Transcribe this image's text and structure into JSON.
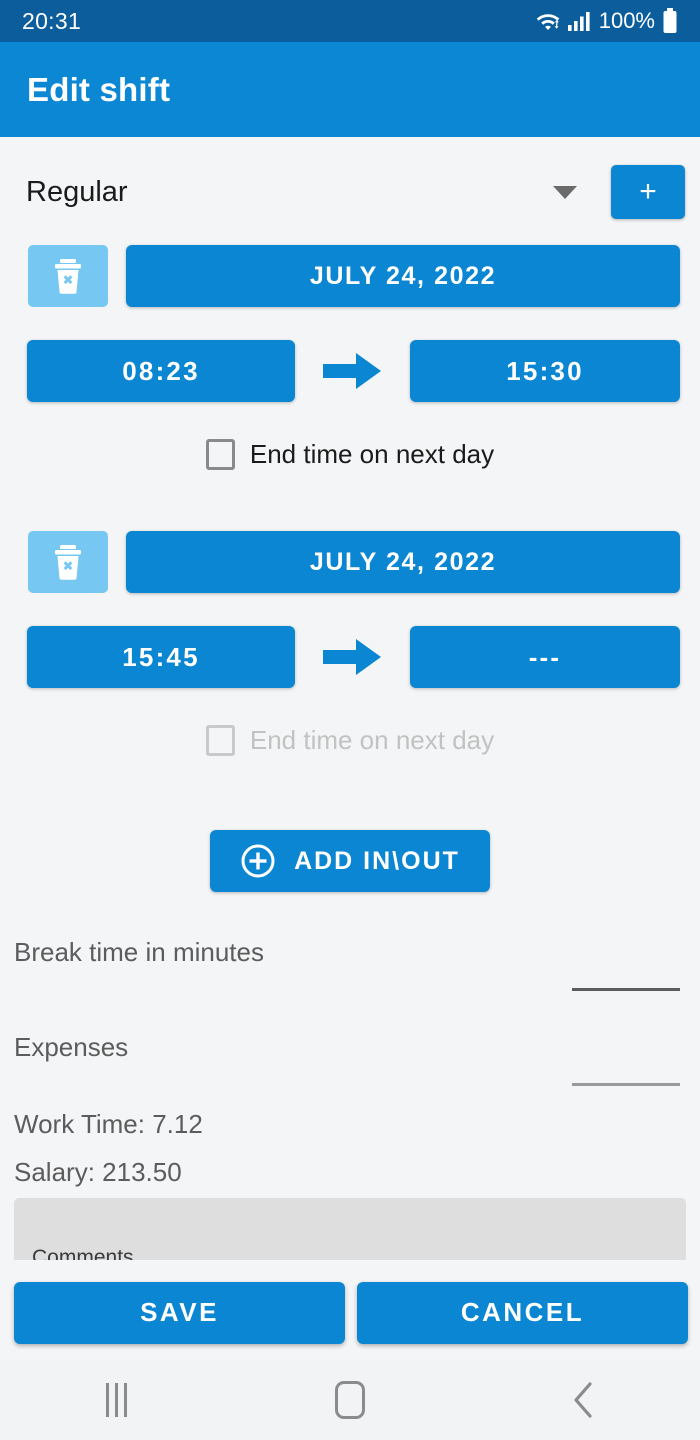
{
  "status_bar": {
    "time": "20:31",
    "battery_percent": "100%",
    "icons": [
      "wifi-icon",
      "cellular-signal-icon",
      "battery-icon"
    ]
  },
  "app_bar": {
    "title": "Edit shift"
  },
  "type_selector": {
    "value": "Regular",
    "caret_icon": "chevron-down-icon",
    "add_label": "+"
  },
  "entries": [
    {
      "delete_icon": "trash-delete-icon",
      "date": "JULY 24, 2022",
      "start_time": "08:23",
      "arrow_icon": "arrow-right-icon",
      "end_time": "15:30",
      "next_day_label": "End time on next day",
      "next_day_checked": false,
      "next_day_disabled": false
    },
    {
      "delete_icon": "trash-delete-icon",
      "date": "JULY 24, 2022",
      "start_time": "15:45",
      "arrow_icon": "arrow-right-icon",
      "end_time": "---",
      "next_day_label": "End time on next day",
      "next_day_checked": false,
      "next_day_disabled": true
    }
  ],
  "add_inout": {
    "label": "ADD IN\\OUT",
    "icon": "plus-circle-icon"
  },
  "fields": [
    {
      "label": "Break time in minutes",
      "value": "",
      "placeholder": ""
    },
    {
      "label": "Expenses",
      "value": "",
      "placeholder": ""
    }
  ],
  "summary": {
    "work_time": "Work Time: 7.12",
    "salary": "Salary: 213.50"
  },
  "comments": {
    "value": "",
    "hint": "Comments"
  },
  "actions": {
    "save_label": "SAVE",
    "cancel_label": "CANCEL"
  },
  "nav_bar": {
    "recents_icon": "recents-icon",
    "home_icon": "home-icon",
    "back_icon": "back-icon"
  },
  "colors": {
    "status_bar": "#0b5d9c",
    "app_bar": "#0b87d3",
    "primary": "#0b86d2",
    "delete_button": "#76c8f2",
    "page_background": "#f4f5f6",
    "comments_background": "#dedede"
  }
}
